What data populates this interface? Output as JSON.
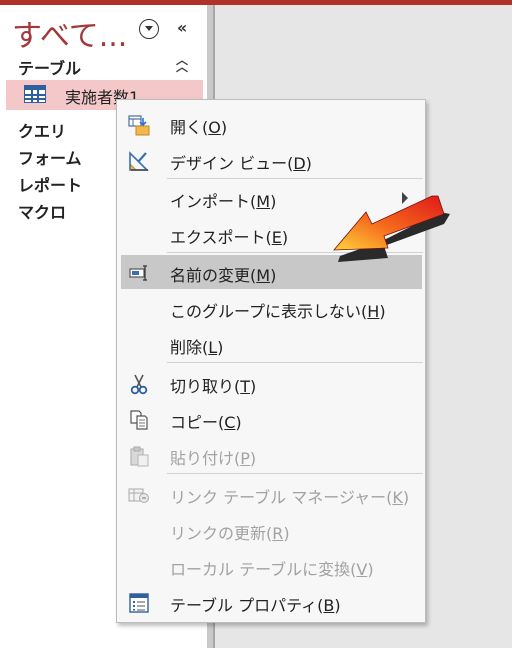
{
  "nav": {
    "title": "すべて...",
    "group_label": "テーブル",
    "selected_item": "実施者数1",
    "categories": [
      "クエリ",
      "フォーム",
      "レポート",
      "マクロ"
    ]
  },
  "context_menu": {
    "items": [
      {
        "label": "開く(",
        "key": "O",
        "suffix": ")",
        "icon": "open-table-icon"
      },
      {
        "label": "デザイン ビュー(",
        "key": "D",
        "suffix": ")",
        "icon": "design-view-icon"
      },
      {
        "label": "インポート(",
        "key": "M",
        "suffix": ")",
        "icon": "",
        "submenu": true
      },
      {
        "label": "エクスポート(",
        "key": "E",
        "suffix": ")",
        "icon": "",
        "submenu": true
      },
      {
        "label": "名前の変更(",
        "key": "M",
        "suffix": ")",
        "icon": "rename-icon",
        "highlighted": true
      },
      {
        "label": "このグループに表示しない(",
        "key": "H",
        "suffix": ")",
        "icon": ""
      },
      {
        "label": "削除(",
        "key": "L",
        "suffix": ")",
        "icon": ""
      },
      {
        "label": "切り取り(",
        "key": "T",
        "suffix": ")",
        "icon": "cut-icon"
      },
      {
        "label": "コピー(",
        "key": "C",
        "suffix": ")",
        "icon": "copy-icon"
      },
      {
        "label": "貼り付け(",
        "key": "P",
        "suffix": ")",
        "icon": "paste-icon",
        "disabled": true
      },
      {
        "label": "リンク テーブル マネージャー(",
        "key": "K",
        "suffix": ")",
        "icon": "linked-table-manager-icon",
        "disabled": true
      },
      {
        "label": "リンクの更新(",
        "key": "R",
        "suffix": ")",
        "icon": "",
        "disabled": true
      },
      {
        "label": "ローカル テーブルに変換(",
        "key": "V",
        "suffix": ")",
        "icon": "",
        "disabled": true
      },
      {
        "label": "テーブル プロパティ(",
        "key": "B",
        "suffix": ")",
        "icon": "table-properties-icon"
      }
    ]
  },
  "colors": {
    "accent": "#a4373a",
    "selected_bg": "#f4c7c9",
    "highlight_bg": "#c8c8c8",
    "disabled_text": "#a2a2a2",
    "arrow_red": "#e0191a",
    "arrow_yellow": "#ffd43a"
  }
}
